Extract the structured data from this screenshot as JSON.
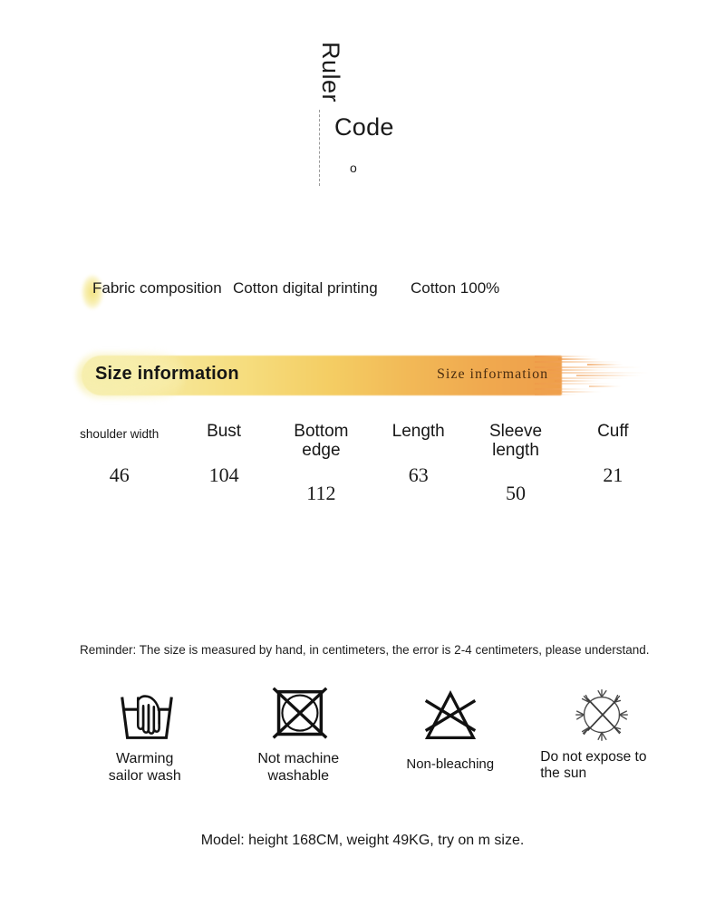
{
  "header": {
    "ruler_label": "Ruler",
    "code_label": "Code",
    "code_mark": "o"
  },
  "fabric": {
    "label": "Fabric composition",
    "value": "Cotton digital printing",
    "extra": "Cotton 100%"
  },
  "size_banner": {
    "title": "Size information",
    "subtitle": "Size  information",
    "accent_light": "#f5eeae",
    "accent_dark": "#ef9f4b"
  },
  "size_table": {
    "columns": [
      {
        "header": "shoulder width",
        "value": "46",
        "small": true
      },
      {
        "header": "Bust",
        "value": "104",
        "small": false
      },
      {
        "header": "Bottom\nedge",
        "value": "112",
        "small": false
      },
      {
        "header": "Length",
        "value": "63",
        "small": false
      },
      {
        "header": "Sleeve\nlength",
        "value": "50",
        "small": false
      },
      {
        "header": "Cuff",
        "value": "21",
        "small": false
      }
    ]
  },
  "reminder": {
    "text": "Reminder: The size is measured by hand, in centimeters, the error is 2-4 centimeters, please understand."
  },
  "care": {
    "items": [
      {
        "icon": "hand-wash-icon",
        "label": "Warming\nsailor wash"
      },
      {
        "icon": "no-machine-wash-icon",
        "label": "Not machine\nwashable"
      },
      {
        "icon": "no-bleach-icon",
        "label": "Non-bleaching"
      },
      {
        "icon": "no-sun-exposure-icon",
        "label": "Do not expose to\nthe sun"
      }
    ]
  },
  "model_note": {
    "text": "Model: height 168CM, weight 49KG, try on m size."
  }
}
